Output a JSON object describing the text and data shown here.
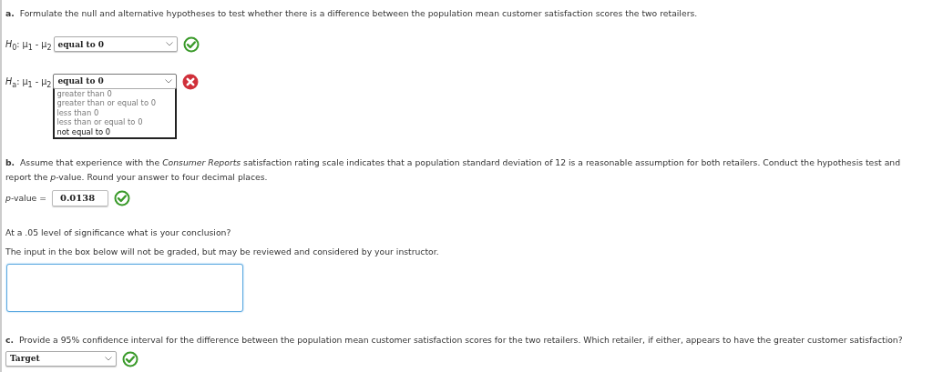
{
  "part_a": {
    "label": "a.",
    "text": "Formulate the null and alternative hypotheses to test whether there is a difference between the population mean customer satisfaction scores the two retailers.",
    "hypotheses": [
      {
        "prefix": "*H*$_{0}$: μ$_{1}$ - μ$_{2}$",
        "select": {
          "value": "equal to 0",
          "expanded": false
        },
        "correct": true
      },
      {
        "prefix": "*H*$_{a}$: μ$_{1}$ - μ$_{2}$",
        "select": {
          "value": "equal to 0",
          "expanded": true,
          "options": [
            {
              "label": "greater than 0",
              "selected": false
            },
            {
              "label": "greater than or equal to 0",
              "selected": false
            },
            {
              "label": "less than 0",
              "selected": false
            },
            {
              "label": "less than or equal to 0",
              "selected": false
            },
            {
              "label": "not equal to 0",
              "selected": true
            }
          ]
        },
        "correct": false
      }
    ]
  },
  "part_b": {
    "label": "b.",
    "text": "Assume that experience with the *Consumer Reports* satisfaction rating scale indicates that a population standard deviation of 12 is a reasonable assumption for both retailers. Conduct the hypothesis test and report the *p*-value. Round your answer to four decimal places.",
    "answer_label": "*p*-value =",
    "answer_value": "0.0138",
    "correct": true,
    "question": "At a .05 level of significance what is your conclusion?",
    "note": "The input in the box below will not be graded, but may be reviewed and considered by your instructor."
  },
  "part_c": {
    "label": "c.",
    "text": "Provide a 95% confidence interval for the difference between the population mean customer satisfaction scores for the two retailers. Which retailer, if either, appears to have the greater customer satisfaction?",
    "select": {
      "value": "Target",
      "expanded": false
    },
    "correct": true
  }
}
